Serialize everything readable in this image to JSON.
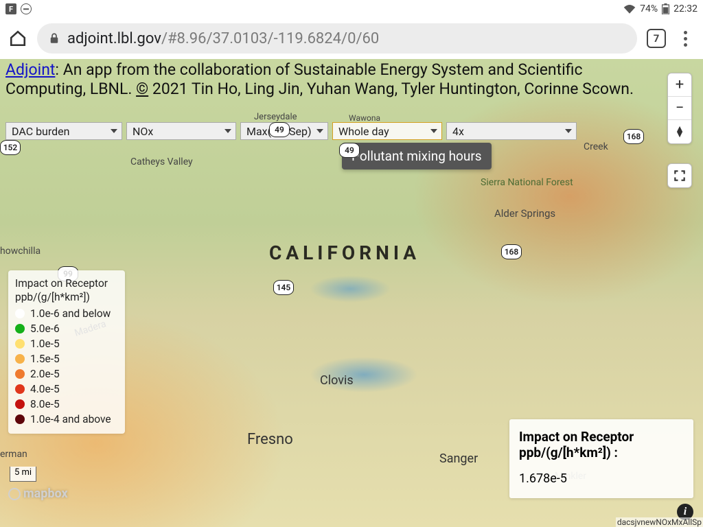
{
  "statusbar": {
    "battery": "74%",
    "time": "22:32"
  },
  "chrome": {
    "tab_count": "7",
    "url_host": "adjoint.lbl.gov",
    "url_path": "/#8.96/37.0103/-119.6824/0/60"
  },
  "header": {
    "link": "Adjoint",
    "desc_a": ": An app from the collaboration of Sustainable Energy System and Scientific Computing, LBNL. ",
    "copyright": "©",
    "desc_b": " 2021 Tin Ho, Ling Jin, Yuhan Wang, Tyler Huntington, Corinne Scown."
  },
  "dropdowns": {
    "d1": "DAC burden",
    "d2": "NOx",
    "d3": "Max(Jul-Sep)",
    "d4": "Whole day",
    "d5": "4x"
  },
  "tooltip": "Pollutant mixing hours",
  "legend": {
    "title": "Impact on Receptor",
    "units": "ppb/(g/[h*km²])",
    "rows": [
      {
        "color": "#ffffff",
        "label": "1.0e-6 and below"
      },
      {
        "color": "#15b01a",
        "label": "5.0e-6"
      },
      {
        "color": "#ffe070",
        "label": "1.0e-5"
      },
      {
        "color": "#f7b24a",
        "label": "1.5e-5"
      },
      {
        "color": "#ef7a2e",
        "label": "2.0e-5"
      },
      {
        "color": "#e0371c",
        "label": "4.0e-5"
      },
      {
        "color": "#c4120e",
        "label": "8.0e-5"
      },
      {
        "color": "#5e050a",
        "label": "1.0e-4 and above"
      }
    ]
  },
  "scale": "5 mi",
  "value_panel": {
    "title": "Impact on Receptor",
    "units": "ppb/(g/[h*km²]) :",
    "value": "1.678e-5"
  },
  "layer_id": "dacsjvnewNOxMxAllSp",
  "map_labels": {
    "state": "CALIFORNIA",
    "l_jerseydale": "Jerseydale",
    "l_wawona": "Wawona",
    "l_catheys": "Catheys Valley",
    "l_chowchilla": "howchilla",
    "l_madera": "Madera",
    "l_clovis": "Clovis",
    "l_fresno": "Fresno",
    "l_sanger": "Sanger",
    "l_minkler": "Minkler",
    "l_alder": "Alder Springs",
    "l_creek": "Creek",
    "l_snf": "Sierra National Forest",
    "l_erman": "erman",
    "r49": "49",
    "r49b": "49",
    "r145": "145",
    "r168": "168",
    "r168b": "168",
    "r99": "99",
    "r152": "152"
  },
  "mapbox": "mapbox"
}
